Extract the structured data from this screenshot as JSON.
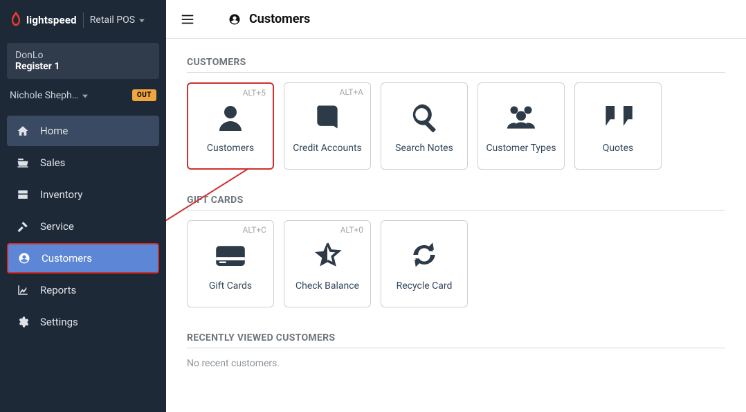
{
  "brand": {
    "name": "lightspeed",
    "product": "Retail POS"
  },
  "context": {
    "store": "DonLo",
    "register": "Register 1"
  },
  "user": {
    "name": "Nichole Sheph…",
    "status_badge": "OUT"
  },
  "nav": {
    "home": "Home",
    "sales": "Sales",
    "inventory": "Inventory",
    "service": "Service",
    "customers": "Customers",
    "reports": "Reports",
    "settings": "Settings"
  },
  "topbar": {
    "title": "Customers"
  },
  "sections": {
    "customers": {
      "title": "CUSTOMERS",
      "cards": {
        "customers": {
          "label": "Customers",
          "shortcut": "ALT+5"
        },
        "credit_accounts": {
          "label": "Credit Accounts",
          "shortcut": "ALT+A"
        },
        "search_notes": {
          "label": "Search Notes",
          "shortcut": ""
        },
        "customer_types": {
          "label": "Customer Types",
          "shortcut": ""
        },
        "quotes": {
          "label": "Quotes",
          "shortcut": ""
        }
      }
    },
    "gift_cards": {
      "title": "GIFT CARDS",
      "cards": {
        "gift_cards": {
          "label": "Gift Cards",
          "shortcut": "ALT+C"
        },
        "check_balance": {
          "label": "Check Balance",
          "shortcut": "ALT+0"
        },
        "recycle_card": {
          "label": "Recycle Card",
          "shortcut": ""
        }
      }
    },
    "recent": {
      "title": "RECENTLY VIEWED CUSTOMERS",
      "empty": "No recent customers."
    }
  }
}
